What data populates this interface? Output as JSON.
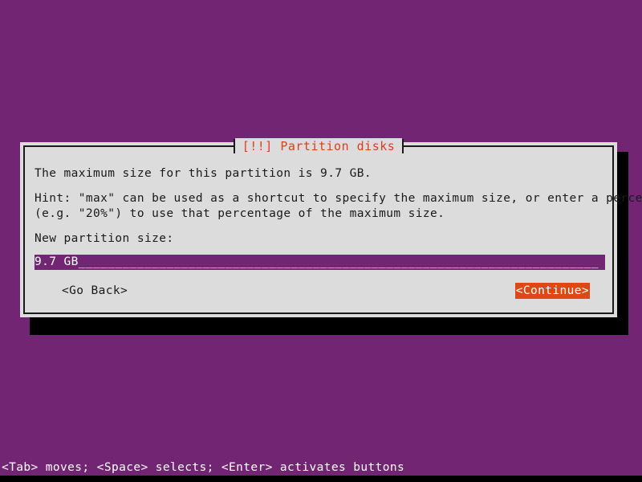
{
  "screen": {
    "background_color": "#722573",
    "bottom_strip_color": "#000000"
  },
  "dialog": {
    "title": "[!!] Partition disks",
    "title_color": "#e03c1e",
    "background_color": "#dcdcdc",
    "border_color": "#1a1a1a",
    "shadow_color": "#000000",
    "body": {
      "line1": "The maximum size for this partition is 9.7 GB.",
      "hint_line1": "Hint: \"max\" can be used as a shortcut to specify the maximum size, or enter a percentage",
      "hint_line2": "(e.g. \"20%\") to use that percentage of the maximum size.",
      "field_label": "New partition size:"
    },
    "input": {
      "value": "9.7 GB_______________________________________________________________________",
      "text_value": "9.7 GB",
      "placeholder": "",
      "background_color": "#722573",
      "text_color": "#ffffff"
    },
    "buttons": {
      "go_back": "<Go Back>",
      "continue": "<Continue>",
      "continue_bg_color": "#dd4814",
      "continue_text_color": "#ffffff",
      "focused": "continue"
    }
  },
  "status_bar": {
    "text": "<Tab> moves; <Space> selects; <Enter> activates buttons",
    "text_color": "#ffffff"
  }
}
